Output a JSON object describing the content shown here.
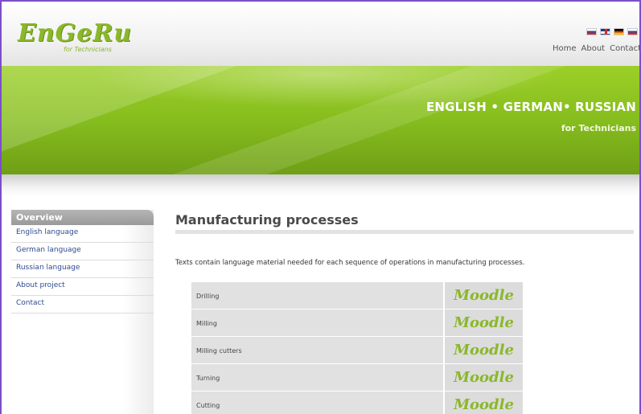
{
  "header": {
    "logo_text": "EnGeRu",
    "logo_subtitle": "for Technicians",
    "flags": [
      "slovak-flag-icon",
      "uk-flag-icon",
      "german-flag-icon",
      "russian-flag-icon"
    ],
    "nav": [
      "Home",
      "About",
      "Contact"
    ]
  },
  "banner": {
    "title": "ENGLISH • GERMAN• RUSSIAN",
    "subtitle": "for Technicians"
  },
  "sidebar": {
    "heading": "Overview",
    "items": [
      "English language",
      "German language",
      "Russian language",
      "About project",
      "Contact"
    ]
  },
  "main": {
    "title": "Manufacturing processes",
    "intro": "Texts contain language material needed for each sequence of operations in manufacturing processes.",
    "rows": [
      {
        "name": "Drilling",
        "link": "Moodle"
      },
      {
        "name": "Milling",
        "link": "Moodle"
      },
      {
        "name": "Milling cutters",
        "link": "Moodle"
      },
      {
        "name": "Turning",
        "link": "Moodle"
      },
      {
        "name": "Cutting",
        "link": "Moodle"
      }
    ]
  },
  "colors": {
    "brand_green": "#8ab82a",
    "banner_green": "#86bd1e",
    "link_blue": "#2e4a90"
  }
}
